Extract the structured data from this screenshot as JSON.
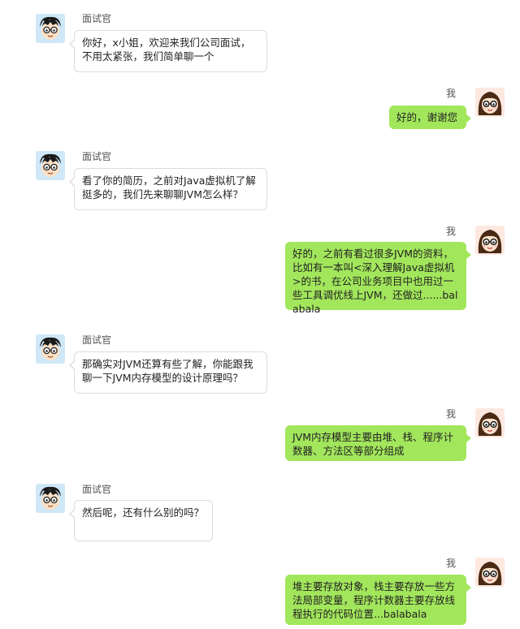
{
  "participants": {
    "interviewer": {
      "name": "面试官",
      "avatar_icon": "boy-glasses-avatar-icon"
    },
    "me": {
      "name": "我",
      "avatar_icon": "girl-glasses-avatar-icon"
    }
  },
  "colors": {
    "my_bubble": "#a2e65c",
    "their_bubble": "#ffffff",
    "their_bubble_border": "#dcdcdc"
  },
  "messages": [
    {
      "sender": "面试官",
      "text": "你好，x小姐，欢迎来我们公司面试，不用太紧张，我们简单聊一个"
    },
    {
      "sender": "我",
      "text": "好的，谢谢您"
    },
    {
      "sender": "面试官",
      "text": "看了你的简历，之前对Java虚拟机了解挺多的，我们先来聊聊JVM怎么样？"
    },
    {
      "sender": "我",
      "text": "好的，之前有看过很多JVM的资料，比如有一本叫<深入理解Java虚拟机>的书，在公司业务项目中也用过一些工具调优线上JVM，还做过......balabala"
    },
    {
      "sender": "面试官",
      "text": "那确实对JVM还算有些了解，你能跟我聊一下JVM内存模型的设计原理吗？"
    },
    {
      "sender": "我",
      "text": "JVM内存模型主要由堆、栈、程序计数器、方法区等部分组成"
    },
    {
      "sender": "面试官",
      "text": "然后呢，还有什么别的吗？"
    },
    {
      "sender": "我",
      "text": "堆主要存放对象，栈主要存放一些方法局部变量，程序计数器主要存放线程执行的代码位置...balabala"
    }
  ]
}
